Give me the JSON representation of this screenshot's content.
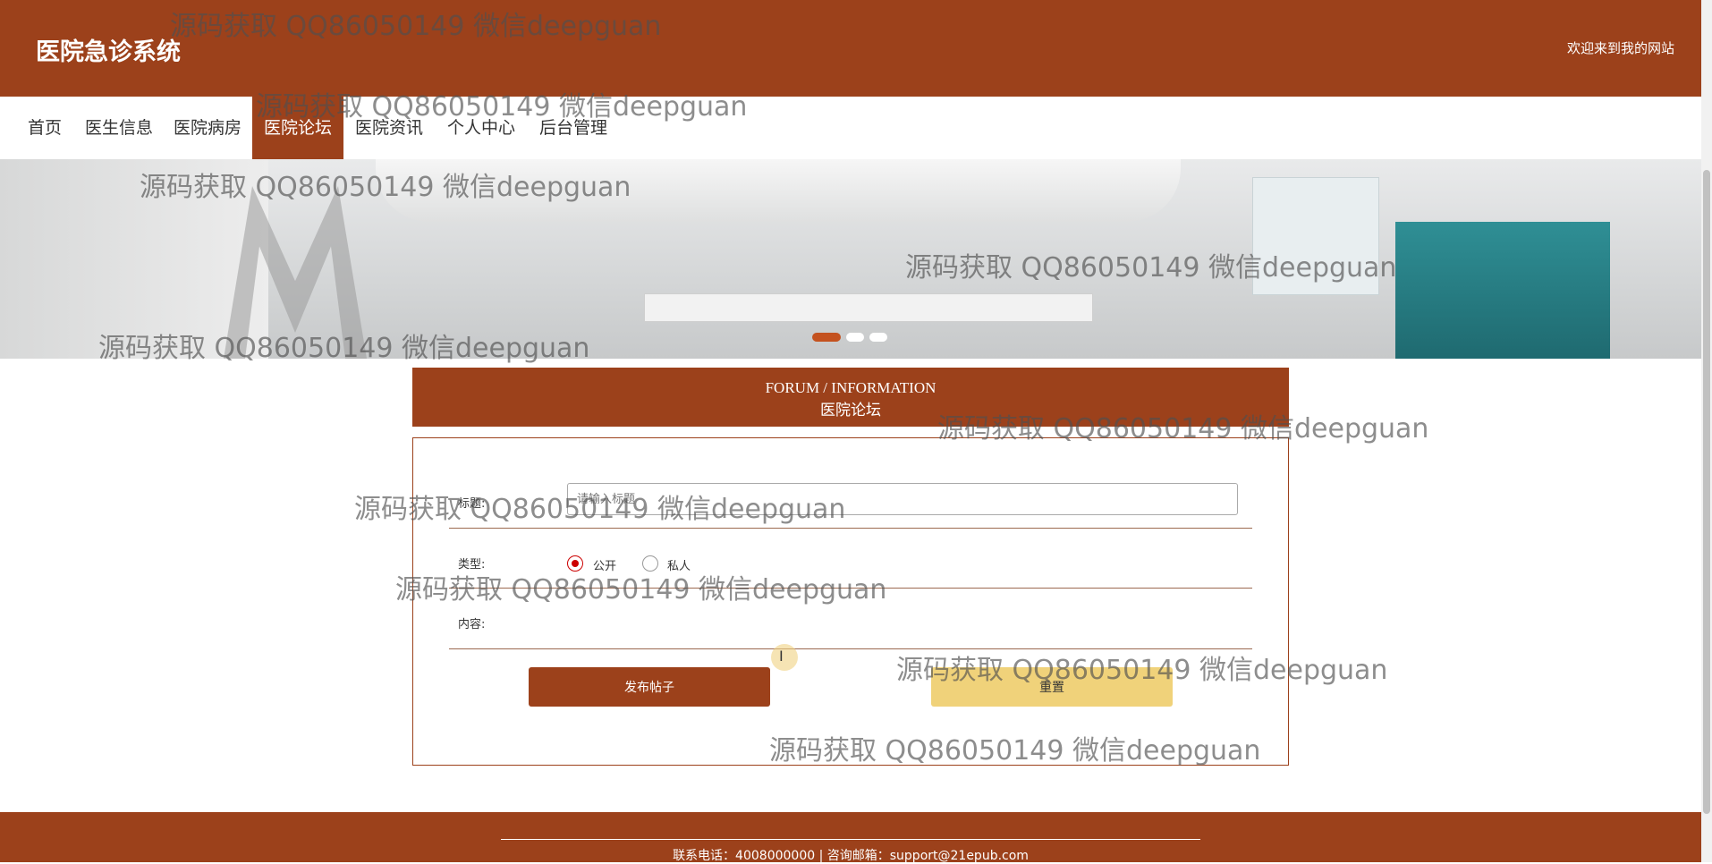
{
  "header": {
    "site_title": "医院急诊系统",
    "welcome_text": "欢迎来到我的网站"
  },
  "nav": {
    "items": [
      {
        "label": "首页"
      },
      {
        "label": "医生信息"
      },
      {
        "label": "医院病房"
      },
      {
        "label": "医院论坛"
      },
      {
        "label": "医院资讯"
      },
      {
        "label": "个人中心"
      },
      {
        "label": "后台管理"
      }
    ],
    "active": "医院论坛"
  },
  "banner": {
    "carousel_slides": 3,
    "active_slide": 1
  },
  "section": {
    "title_en": "FORUM / INFORMATION",
    "title_cn": "医院论坛"
  },
  "form": {
    "title_label": "标题:",
    "title_placeholder": "请输入标题",
    "title_value": "",
    "type_label": "类型:",
    "type_options": [
      "公开",
      "私人"
    ],
    "type_selected": "公开",
    "content_label": "内容:",
    "submit_label": "发布帖子",
    "reset_label": "重置"
  },
  "footer": {
    "contact": "联系电话：4008000000 | 咨询邮箱：support@21epub.com"
  },
  "watermark_text": "源码获取 QQ86050149 微信deepguan",
  "colors": {
    "brand": "#9c411b",
    "reset_button": "#f0d27a",
    "radio_checked": "#cc0000"
  }
}
